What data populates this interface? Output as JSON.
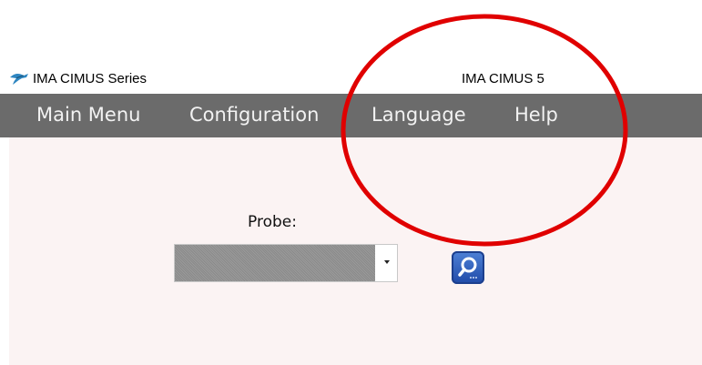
{
  "app": {
    "name": "IMA CIMUS Series",
    "window_title": "IMA CIMUS 5"
  },
  "menu": {
    "items": [
      {
        "label": "Main Menu"
      },
      {
        "label": "Configuration"
      },
      {
        "label": "Language"
      },
      {
        "label": "Help"
      }
    ]
  },
  "probe": {
    "label": "Probe:",
    "selected": ""
  },
  "search_button": {
    "icon": "magnifier-icon"
  },
  "colors": {
    "menubar_bg": "#6b6b6b",
    "content_bg": "#fbf3f3",
    "annotation": "#e00000",
    "search_button": "#2d5bbd"
  }
}
